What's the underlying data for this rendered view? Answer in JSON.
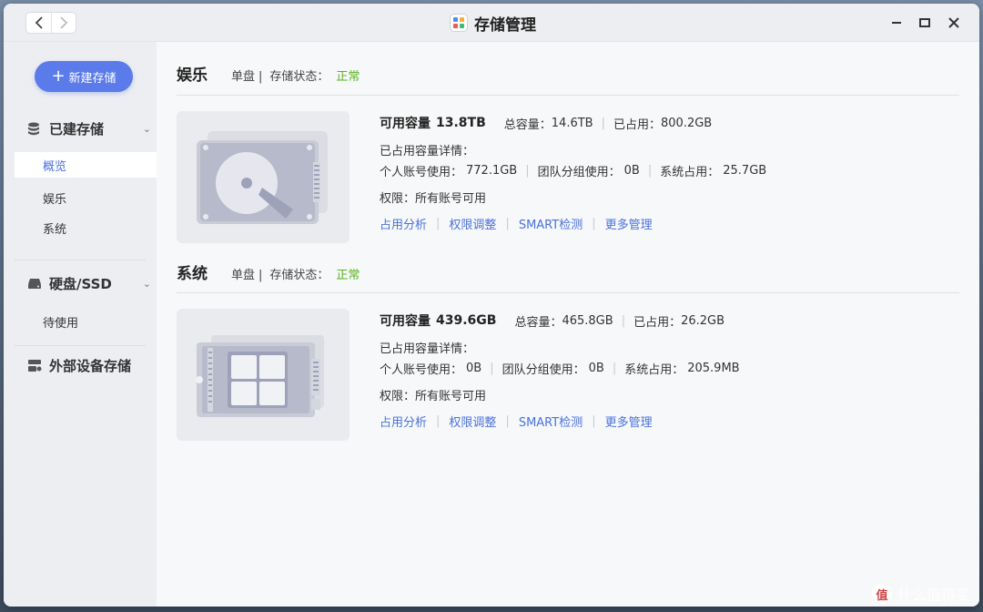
{
  "window": {
    "title": "存储管理"
  },
  "sidebar": {
    "new_button": "新建存储",
    "groups": [
      {
        "label": "已建存储",
        "icon": "database-icon",
        "items": [
          "概览",
          "娱乐",
          "系统"
        ]
      },
      {
        "label": "硬盘/SSD",
        "icon": "drive-icon",
        "items": [
          "待使用"
        ]
      },
      {
        "label": "外部设备存储",
        "icon": "external-device-icon",
        "items": []
      }
    ],
    "active_item": "概览"
  },
  "labels": {
    "type": "单盘",
    "status": "存储状态：",
    "available_prefix": "可用容量",
    "total": "总容量：",
    "used": "已占用：",
    "used_detail": "已占用容量详情：",
    "personal": "个人账号使用：",
    "team": "团队分组使用：",
    "system": "系统占用：",
    "permission": "权限：所有账号可用"
  },
  "actions": [
    "占用分析",
    "权限调整",
    "SMART检测",
    "更多管理"
  ],
  "volumes": [
    {
      "name": "娱乐",
      "status": "正常",
      "available": "13.8TB",
      "total": "14.6TB",
      "used": "800.2GB",
      "personal": "772.1GB",
      "team": "0B",
      "system": "25.7GB",
      "icon": "hdd-icon"
    },
    {
      "name": "系统",
      "status": "正常",
      "available": "439.6GB",
      "total": "465.8GB",
      "used": "26.2GB",
      "personal": "0B",
      "team": "0B",
      "system": "205.9MB",
      "icon": "ssd-icon"
    }
  ],
  "watermark": {
    "badge": "值",
    "text": "什么值得买"
  },
  "colors": {
    "accent": "#5a7be9",
    "link": "#4a72dd",
    "ok": "#58b31f"
  }
}
